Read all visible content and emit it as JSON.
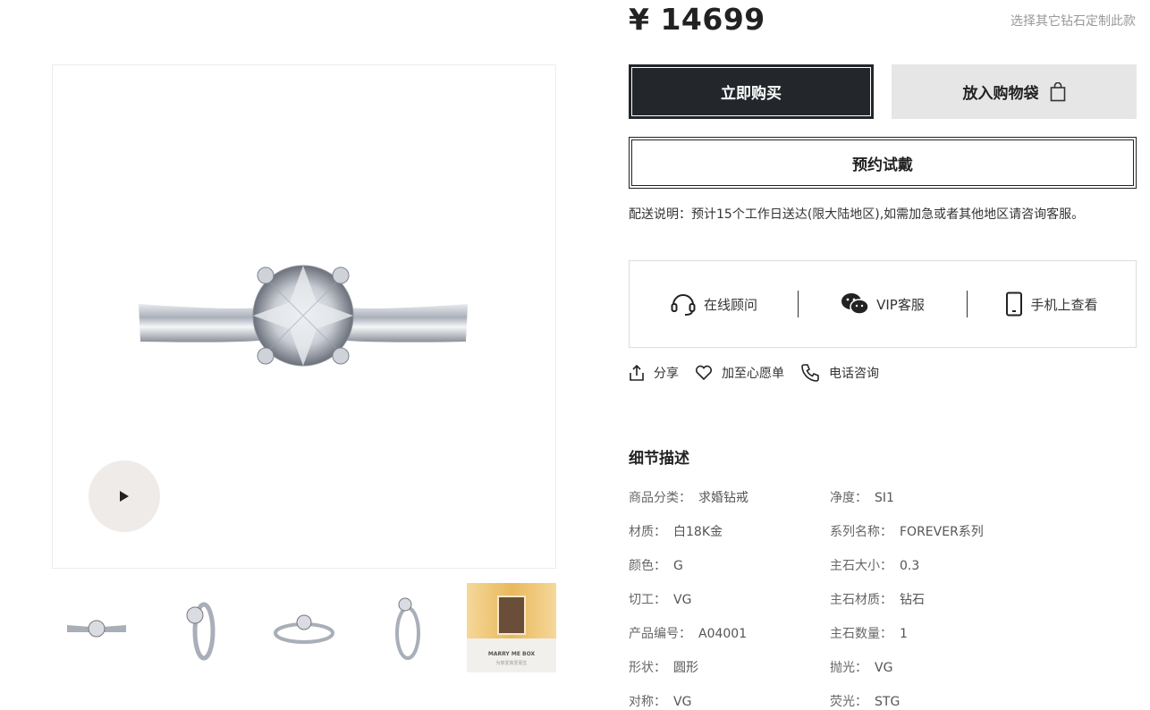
{
  "price": "¥ 14699",
  "customize_link": "选择其它钻石定制此款",
  "buttons": {
    "buy_now": "立即购买",
    "add_to_bag": "放入购物袋",
    "book_tryon": "预约试戴"
  },
  "delivery_note": "配送说明：预计15个工作日送达(限大陆地区),如需加急或者其他地区请咨询客服。",
  "services": [
    {
      "label": "在线顾问",
      "icon": "headset-icon"
    },
    {
      "label": "VIP客服",
      "icon": "wechat-icon"
    },
    {
      "label": "手机上查看",
      "icon": "mobile-phone-icon"
    }
  ],
  "actions": [
    {
      "label": "分享",
      "icon": "share-icon"
    },
    {
      "label": "加至心愿单",
      "icon": "heart-icon"
    },
    {
      "label": "电话咨询",
      "icon": "phone-icon"
    }
  ],
  "details": {
    "title": "细节描述",
    "left": [
      {
        "key": "商品分类：",
        "value": "求婚钻戒"
      },
      {
        "key": "材质：",
        "value": "白18K金"
      },
      {
        "key": "颜色：",
        "value": "G"
      },
      {
        "key": "切工：",
        "value": "VG"
      },
      {
        "key": "产品编号：",
        "value": "A04001"
      },
      {
        "key": "形状：",
        "value": "圆形"
      },
      {
        "key": "对称：",
        "value": "VG"
      }
    ],
    "right": [
      {
        "key": "净度：",
        "value": "SI1"
      },
      {
        "key": "系列名称：",
        "value": "FOREVER系列"
      },
      {
        "key": "主石大小：",
        "value": "0.3"
      },
      {
        "key": "主石材质：",
        "value": "钻石"
      },
      {
        "key": "主石数量：",
        "value": "1"
      },
      {
        "key": "抛光：",
        "value": "VG"
      },
      {
        "key": "荧光：",
        "value": "STG"
      }
    ]
  },
  "gallery": {
    "box_text_1": "MARRY ME BOX",
    "box_text_2": "为挚爱真爱而生"
  },
  "colors": {
    "buy_button": "#23272c",
    "bag_button": "#e6e6e6",
    "play_button": "#efebe9"
  }
}
